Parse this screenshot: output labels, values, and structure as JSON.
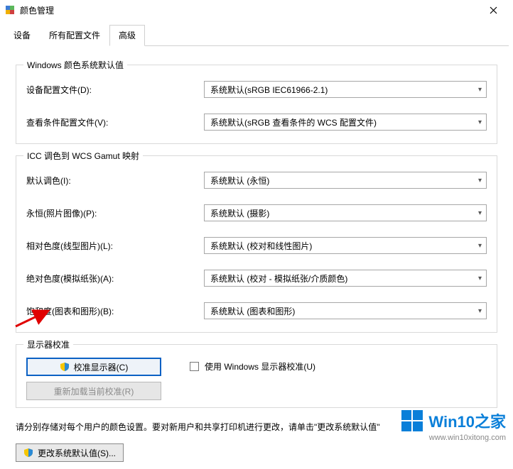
{
  "window": {
    "title": "颜色管理"
  },
  "tabs": {
    "device": "设备",
    "profiles": "所有配置文件",
    "advanced": "高级"
  },
  "group_defaults": {
    "legend": "Windows 颜色系统默认值",
    "device_profile_label": "设备配置文件(D):",
    "device_profile_value": "系统默认(sRGB IEC61966-2.1)",
    "viewing_label": "查看条件配置文件(V):",
    "viewing_value": "系统默认(sRGB 查看条件的 WCS 配置文件)"
  },
  "group_gamut": {
    "legend": "ICC 调色到 WCS Gamut 映射",
    "default_intent_label": "默认调色(I):",
    "default_intent_value": "系统默认 (永恒)",
    "perceptual_label": "永恒(照片图像)(P):",
    "perceptual_value": "系统默认 (摄影)",
    "relative_label": "相对色度(线型图片)(L):",
    "relative_value": "系统默认 (校对和线性图片)",
    "absolute_label": "绝对色度(模拟纸张)(A):",
    "absolute_value": "系统默认 (校对 - 模拟纸张/介质颜色)",
    "saturation_label": "饱和度(图表和图形)(B):",
    "saturation_value": "系统默认 (图表和图形)"
  },
  "group_calibration": {
    "legend": "显示器校准",
    "calibrate_button": "校准显示器(C)",
    "reload_button": "重新加载当前校准(R)",
    "use_win_calib": "使用 Windows 显示器校准(U)"
  },
  "note_text": "请分别存储对每个用户的颜色设置。要对新用户和共享打印机进行更改，请单击\"更改系统默认值\"",
  "change_defaults_button": "更改系统默认值(S)...",
  "watermark": {
    "brand_en": "Win10",
    "brand_zh": "之家",
    "url": "www.win10xitong.com"
  }
}
